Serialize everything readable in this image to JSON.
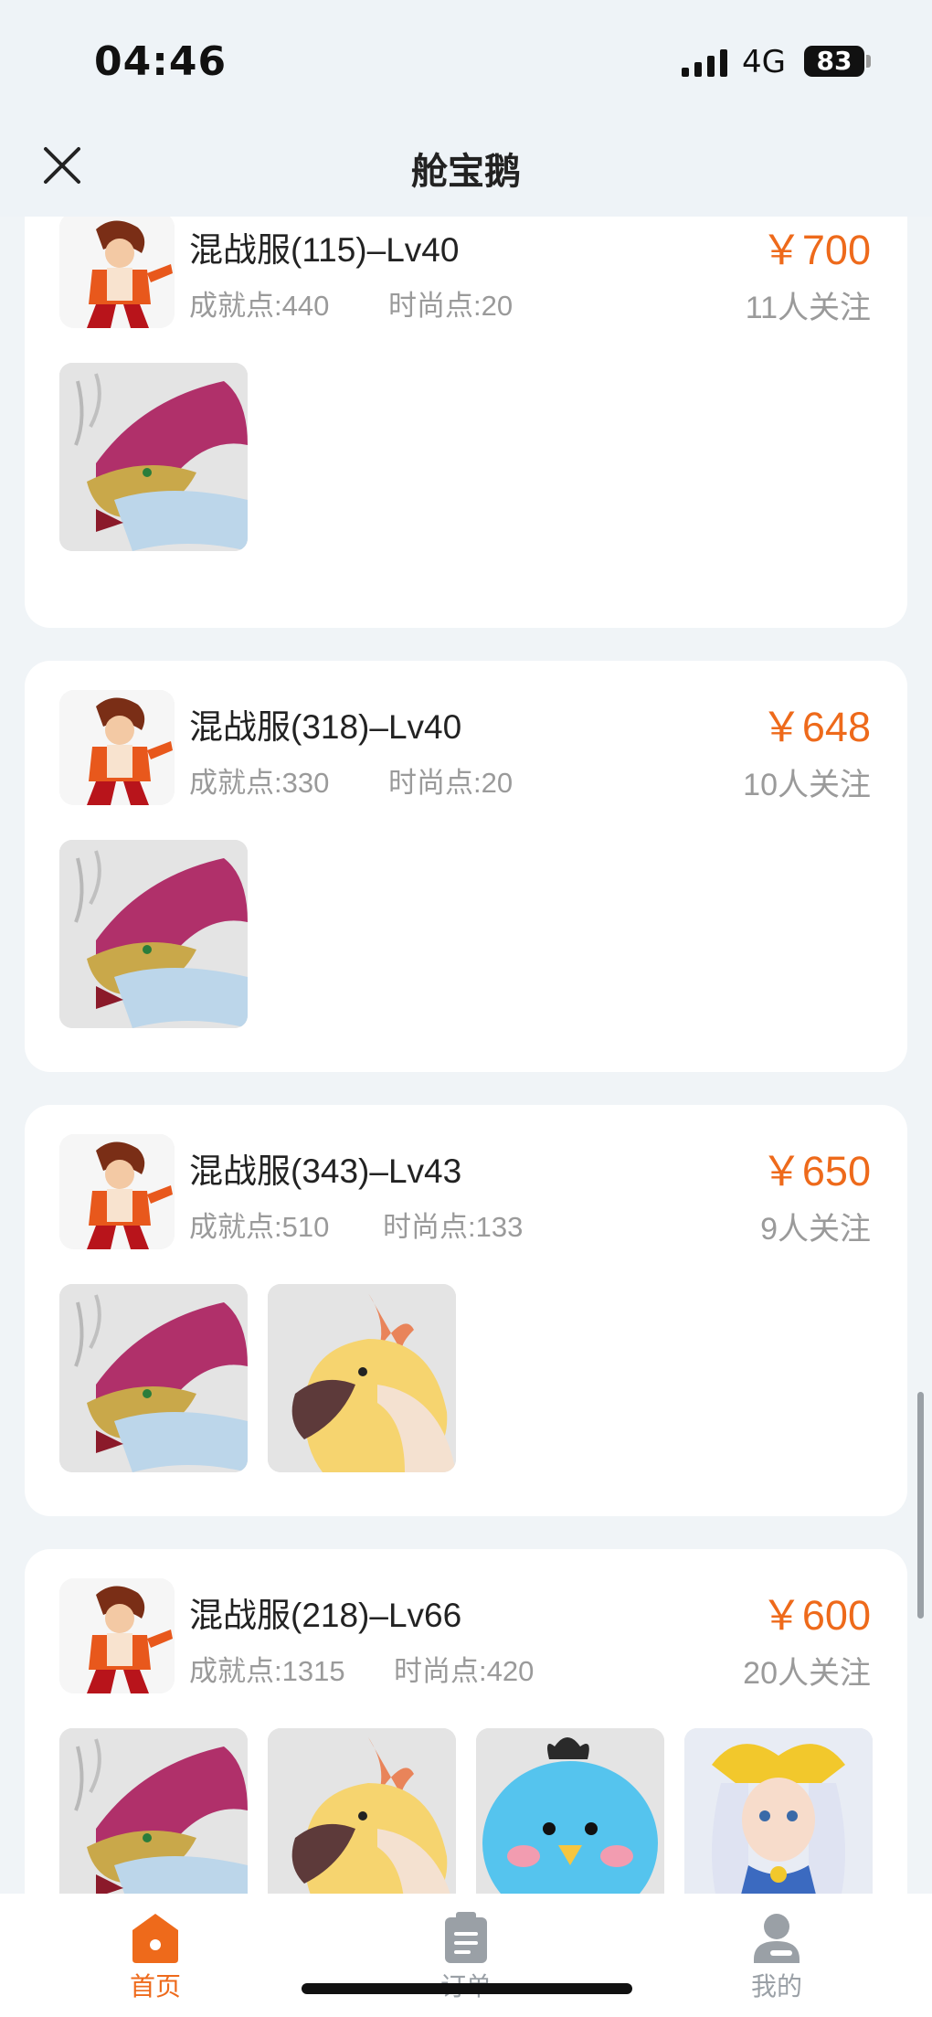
{
  "status": {
    "time": "04:46",
    "network": "4G",
    "battery": "83"
  },
  "header": {
    "title": "舱宝鹅",
    "close_icon": "close-icon"
  },
  "colors": {
    "accent": "#ee6a1b",
    "secondary_text": "#9a9a9a",
    "tab_inactive": "#9aa0a6"
  },
  "listings": [
    {
      "name": "混战服(115)–Lv40",
      "achievement": "成就点:440",
      "fashion": "时尚点:20",
      "price": "￥700",
      "followers": "11人关注",
      "items": [
        "dragon-mount"
      ]
    },
    {
      "name": "混战服(318)–Lv40",
      "achievement": "成就点:330",
      "fashion": "时尚点:20",
      "price": "￥648",
      "followers": "10人关注",
      "items": [
        "dragon-mount"
      ]
    },
    {
      "name": "混战服(343)–Lv43",
      "achievement": "成就点:510",
      "fashion": "时尚点:133",
      "price": "￥650",
      "followers": "9人关注",
      "items": [
        "dragon-mount",
        "phoenix-mount"
      ]
    },
    {
      "name": "混战服(218)–Lv66",
      "achievement": "成就点:1315",
      "fashion": "时尚点:420",
      "price": "￥600",
      "followers": "20人关注",
      "items": [
        "dragon-mount",
        "phoenix-mount",
        "blue-bird-pet",
        "winged-princess-outfit"
      ]
    }
  ],
  "tabs": [
    {
      "label": "首页",
      "icon": "home-icon",
      "active": true
    },
    {
      "label": "订单",
      "icon": "order-icon",
      "active": false
    },
    {
      "label": "我的",
      "icon": "profile-icon",
      "active": false
    }
  ]
}
